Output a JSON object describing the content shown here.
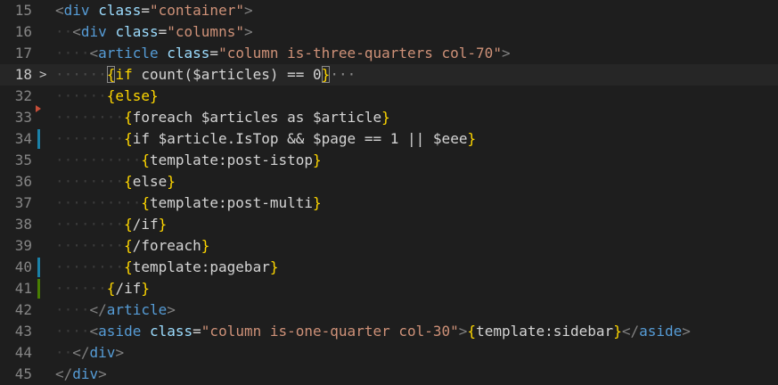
{
  "lines": [
    {
      "no": "15",
      "fold": "",
      "mark": "",
      "active": false,
      "tokens": [
        [
          "angle",
          "<"
        ],
        [
          "tag",
          "div"
        ],
        [
          "ws",
          " "
        ],
        [
          "attr",
          "class"
        ],
        [
          "txt",
          "="
        ],
        [
          "str",
          "\"container\""
        ],
        [
          "angle",
          ">"
        ]
      ]
    },
    {
      "no": "16",
      "fold": "",
      "mark": "",
      "active": false,
      "tokens": [
        [
          "ws",
          "··"
        ],
        [
          "angle",
          "<"
        ],
        [
          "tag",
          "div"
        ],
        [
          "ws",
          " "
        ],
        [
          "attr",
          "class"
        ],
        [
          "txt",
          "="
        ],
        [
          "str",
          "\"columns\""
        ],
        [
          "angle",
          ">"
        ]
      ]
    },
    {
      "no": "17",
      "fold": "",
      "mark": "",
      "active": false,
      "tokens": [
        [
          "ws",
          "····"
        ],
        [
          "angle",
          "<"
        ],
        [
          "tag",
          "article"
        ],
        [
          "ws",
          " "
        ],
        [
          "attr",
          "class"
        ],
        [
          "txt",
          "="
        ],
        [
          "str",
          "\"column is-three-quarters col-70\""
        ],
        [
          "angle",
          ">"
        ]
      ]
    },
    {
      "no": "18",
      "fold": ">",
      "mark": "",
      "active": true,
      "tokens": [
        [
          "ws-sel",
          "······"
        ],
        [
          "kwb",
          "{"
        ],
        [
          "kw",
          "if"
        ],
        [
          "ws-sel",
          " "
        ],
        [
          "txt",
          "count("
        ],
        [
          "var",
          "$articles"
        ],
        [
          "txt",
          ")"
        ],
        [
          "ws-sel",
          " "
        ],
        [
          "txt",
          "=="
        ],
        [
          "ws-sel",
          " "
        ],
        [
          "txt",
          "0"
        ],
        [
          "kwb",
          "}"
        ],
        [
          "ell",
          "···"
        ]
      ]
    },
    {
      "no": "32",
      "fold": "",
      "mark": "",
      "active": false,
      "tokens": [
        [
          "ws",
          "······"
        ],
        [
          "kw",
          "{else}"
        ]
      ]
    },
    {
      "no": "33",
      "fold": "",
      "mark": "deleted",
      "active": false,
      "tokens": [
        [
          "ws",
          "········"
        ],
        [
          "kw",
          "{"
        ],
        [
          "txt",
          "foreach"
        ],
        [
          "ws",
          " "
        ],
        [
          "var",
          "$articles"
        ],
        [
          "ws",
          " "
        ],
        [
          "txt",
          "as"
        ],
        [
          "ws",
          " "
        ],
        [
          "var",
          "$article"
        ],
        [
          "kw",
          "}"
        ]
      ]
    },
    {
      "no": "34",
      "fold": "",
      "mark": "modified",
      "active": false,
      "tokens": [
        [
          "ws",
          "········"
        ],
        [
          "kw",
          "{"
        ],
        [
          "txt",
          "if"
        ],
        [
          "ws",
          " "
        ],
        [
          "var",
          "$article.IsTop"
        ],
        [
          "ws",
          " "
        ],
        [
          "txt",
          "&&"
        ],
        [
          "ws",
          " "
        ],
        [
          "var",
          "$page"
        ],
        [
          "ws",
          " "
        ],
        [
          "txt",
          "=="
        ],
        [
          "ws",
          " "
        ],
        [
          "txt",
          "1"
        ],
        [
          "ws",
          " "
        ],
        [
          "txt",
          "||"
        ],
        [
          "ws",
          " "
        ],
        [
          "var",
          "$eee"
        ],
        [
          "kw",
          "}"
        ]
      ]
    },
    {
      "no": "35",
      "fold": "",
      "mark": "",
      "active": false,
      "tokens": [
        [
          "ws",
          "··········"
        ],
        [
          "kw",
          "{"
        ],
        [
          "txt",
          "template:post-istop"
        ],
        [
          "kw",
          "}"
        ]
      ]
    },
    {
      "no": "36",
      "fold": "",
      "mark": "",
      "active": false,
      "tokens": [
        [
          "ws",
          "········"
        ],
        [
          "kw",
          "{"
        ],
        [
          "txt",
          "else"
        ],
        [
          "kw",
          "}"
        ]
      ]
    },
    {
      "no": "37",
      "fold": "",
      "mark": "",
      "active": false,
      "tokens": [
        [
          "ws",
          "··········"
        ],
        [
          "kw",
          "{"
        ],
        [
          "txt",
          "template:post-multi"
        ],
        [
          "kw",
          "}"
        ]
      ]
    },
    {
      "no": "38",
      "fold": "",
      "mark": "",
      "active": false,
      "tokens": [
        [
          "ws",
          "········"
        ],
        [
          "kw",
          "{"
        ],
        [
          "txt",
          "/if"
        ],
        [
          "kw",
          "}"
        ]
      ]
    },
    {
      "no": "39",
      "fold": "",
      "mark": "",
      "active": false,
      "tokens": [
        [
          "ws",
          "········"
        ],
        [
          "kw",
          "{"
        ],
        [
          "txt",
          "/foreach"
        ],
        [
          "kw",
          "}"
        ]
      ]
    },
    {
      "no": "40",
      "fold": "",
      "mark": "modified",
      "active": false,
      "tokens": [
        [
          "ws",
          "········"
        ],
        [
          "kw",
          "{"
        ],
        [
          "txt",
          "template:pagebar"
        ],
        [
          "kw",
          "}"
        ]
      ]
    },
    {
      "no": "41",
      "fold": "",
      "mark": "added",
      "active": false,
      "tokens": [
        [
          "ws",
          "······"
        ],
        [
          "kw",
          "{"
        ],
        [
          "txt",
          "/if"
        ],
        [
          "kw",
          "}"
        ]
      ]
    },
    {
      "no": "42",
      "fold": "",
      "mark": "",
      "active": false,
      "tokens": [
        [
          "ws",
          "····"
        ],
        [
          "angle",
          "</"
        ],
        [
          "tag",
          "article"
        ],
        [
          "angle",
          ">"
        ]
      ]
    },
    {
      "no": "43",
      "fold": "",
      "mark": "",
      "active": false,
      "tokens": [
        [
          "ws",
          "····"
        ],
        [
          "angle",
          "<"
        ],
        [
          "tag",
          "aside"
        ],
        [
          "ws",
          " "
        ],
        [
          "attr",
          "class"
        ],
        [
          "txt",
          "="
        ],
        [
          "str",
          "\"column is-one-quarter col-30\""
        ],
        [
          "angle",
          ">"
        ],
        [
          "kw",
          "{"
        ],
        [
          "txt",
          "template:sidebar"
        ],
        [
          "kw",
          "}"
        ],
        [
          "angle",
          "</"
        ],
        [
          "tag",
          "aside"
        ],
        [
          "angle",
          ">"
        ]
      ]
    },
    {
      "no": "44",
      "fold": "",
      "mark": "",
      "active": false,
      "tokens": [
        [
          "ws",
          "··"
        ],
        [
          "angle",
          "</"
        ],
        [
          "tag",
          "div"
        ],
        [
          "angle",
          ">"
        ]
      ]
    },
    {
      "no": "45",
      "fold": "",
      "mark": "",
      "active": false,
      "tokens": [
        [
          "angle",
          "</"
        ],
        [
          "tag",
          "div"
        ],
        [
          "angle",
          ">"
        ]
      ]
    }
  ]
}
